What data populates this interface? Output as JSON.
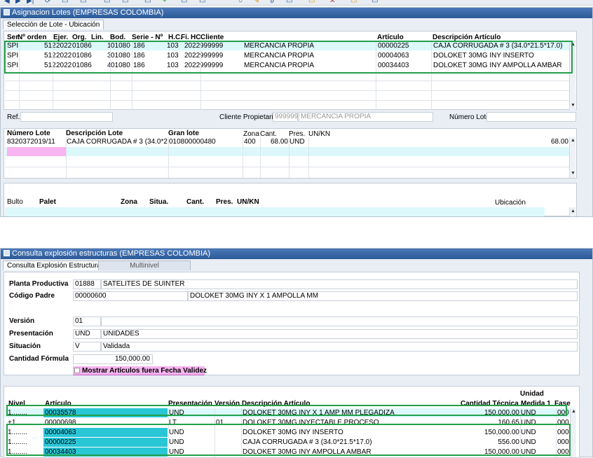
{
  "toolbar": {
    "icons": [
      "back-icon",
      "forward-icon",
      "last-icon",
      "refresh-icon",
      "print-icon",
      "copy-icon",
      "new-icon",
      "save-icon",
      "search-icon",
      "edit-icon",
      "paste-icon",
      "zoom-icon",
      "lock-icon",
      "delete-icon",
      "warning-icon",
      "export-icon"
    ]
  },
  "win1": {
    "title": "Asignacion Lotes (EMPRESAS COLOMBIA)",
    "tab": "Selección de Lote - Ubicación",
    "headers": [
      "Ser.",
      "Nº orden",
      "Ejer.",
      "Org.",
      "Lin.",
      "Bod.",
      "Serie - Nº",
      "H.C.",
      "Fi.",
      "HC",
      "Cliente",
      "Artículo",
      "Descripción Artículo"
    ],
    "rows": [
      {
        "ser": "SPI",
        "orden": "512",
        "ejer": "2022",
        "org": "01086",
        "lin": "1",
        "bod": "01080",
        "serie": "186",
        "n": "103",
        "fi": "2022",
        "hc": "999999",
        "cliente": "MERCANCIA PROPIA",
        "articulo": "00000225",
        "desc": "CAJA CORRUGADA # 3 (34.0*21.5*17.0)"
      },
      {
        "ser": "SPI",
        "orden": "512",
        "ejer": "2022",
        "org": "01086",
        "lin": "3",
        "bod": "01080",
        "serie": "186",
        "n": "103",
        "fi": "2022",
        "hc": "999999",
        "cliente": "MERCANCIA PROPIA",
        "articulo": "00004063",
        "desc": "DOLOKET 30MG INY INSERTO"
      },
      {
        "ser": "SPI",
        "orden": "512",
        "ejer": "2022",
        "org": "01086",
        "lin": "4",
        "bod": "01080",
        "serie": "186",
        "n": "103",
        "fi": "2022",
        "hc": "999999",
        "cliente": "MERCANCIA PROPIA",
        "articulo": "00034403",
        "desc": "DOLOKET 30MG INY AMPOLLA AMBAR"
      }
    ],
    "ref_label": "Ref.",
    "ref_value": "",
    "cliente_prop_label": "Cliente Propietario",
    "cliente_prop_code": "999999",
    "cliente_prop_name": "MERCANCIA PROPIA",
    "numero_lote_label": "Número Lote",
    "numero_lote_value": "",
    "lote_headers": [
      "Número Lote",
      "Descripción Lote",
      "Gran lote",
      "Zona",
      "Cant.",
      "Pres.",
      "UN/KN"
    ],
    "lote_row": {
      "numero": "8320372019/11",
      "desc": "CAJA CORRUGADA # 3 (34.0*21.5",
      "gran": "010800000480",
      "zona": "400",
      "cant": "68.00",
      "pres": "UND",
      "unkn": "",
      "right_value": "68.00"
    },
    "bulto_headers": [
      "Bulto",
      "Palet",
      "Zona",
      "Situa.",
      "Cant.",
      "Pres.",
      "UN/KN",
      "Ubicación"
    ]
  },
  "win2": {
    "title": "Consulta explosión estructuras (EMPRESAS COLOMBIA)",
    "tabs": [
      "Consulta Explosión Estructuras",
      "Multinivel"
    ],
    "planta_label": "Planta Productiva",
    "planta_code": "01888",
    "planta_name": "SATELITES DE  SUINTER",
    "codigo_padre_label": "Código Padre",
    "codigo_padre_code": "00000600",
    "codigo_padre_name": "DOLOKET 30MG INY X 1 AMPOLLA MM",
    "version_label": "Versión",
    "version_value": "01",
    "presentacion_label": "Presentación",
    "presentacion_code": "UND",
    "presentacion_name": "UNIDADES",
    "situacion_label": "Situación",
    "situacion_code": "V",
    "situacion_name": "Validada",
    "cantidad_label": "Cantidad Fórmula",
    "cantidad_value": "150,000.00",
    "checkbox_label": "Mostrar Artículos fuera Fecha Validez",
    "headers": [
      "Nivel",
      "Artículo",
      "Presentación",
      "Versión",
      "Descripción Artículo",
      "Cantidad Técnica",
      "Unidad Medida 1",
      "Fase"
    ],
    "header_unidad_top": "Unidad",
    "header_unidad_bottom": "Medida 1",
    "rows": [
      {
        "nivel": "1........",
        "articulo": "00035578",
        "pres": "UND",
        "version": "",
        "desc": "DOLOKET 30MG INY X 1 AMP MM PLEGADIZA",
        "cant": "150,000.00",
        "um": "UND",
        "fase": "000"
      },
      {
        "nivel": "+1.........",
        "articulo": "00000698",
        "pres": "LT",
        "version": "01",
        "desc": "DOLOKET 30MG INYECTABLE PROCESO",
        "cant": "160.65",
        "um": "UND",
        "fase": "000"
      },
      {
        "nivel": "1........",
        "articulo": "00004063",
        "pres": "UND",
        "version": "",
        "desc": "DOLOKET 30MG INY INSERTO",
        "cant": "150,000.00",
        "um": "UND",
        "fase": "000"
      },
      {
        "nivel": "1........",
        "articulo": "00000225",
        "pres": "UND",
        "version": "",
        "desc": "CAJA CORRUGADA # 3 (34.0*21.5*17.0)",
        "cant": "556.00",
        "um": "UND",
        "fase": "000"
      },
      {
        "nivel": "1........",
        "articulo": "00034403",
        "pres": "UND",
        "version": "",
        "desc": "DOLOKET 30MG INY AMPOLLA AMBAR",
        "cant": "150,000.00",
        "um": "UND",
        "fase": "000"
      }
    ]
  },
  "colors": {
    "highlight": "#22a04a",
    "cyan": "#29c6d6",
    "title": "#2c5a98",
    "pink": "#f8b4f0"
  }
}
